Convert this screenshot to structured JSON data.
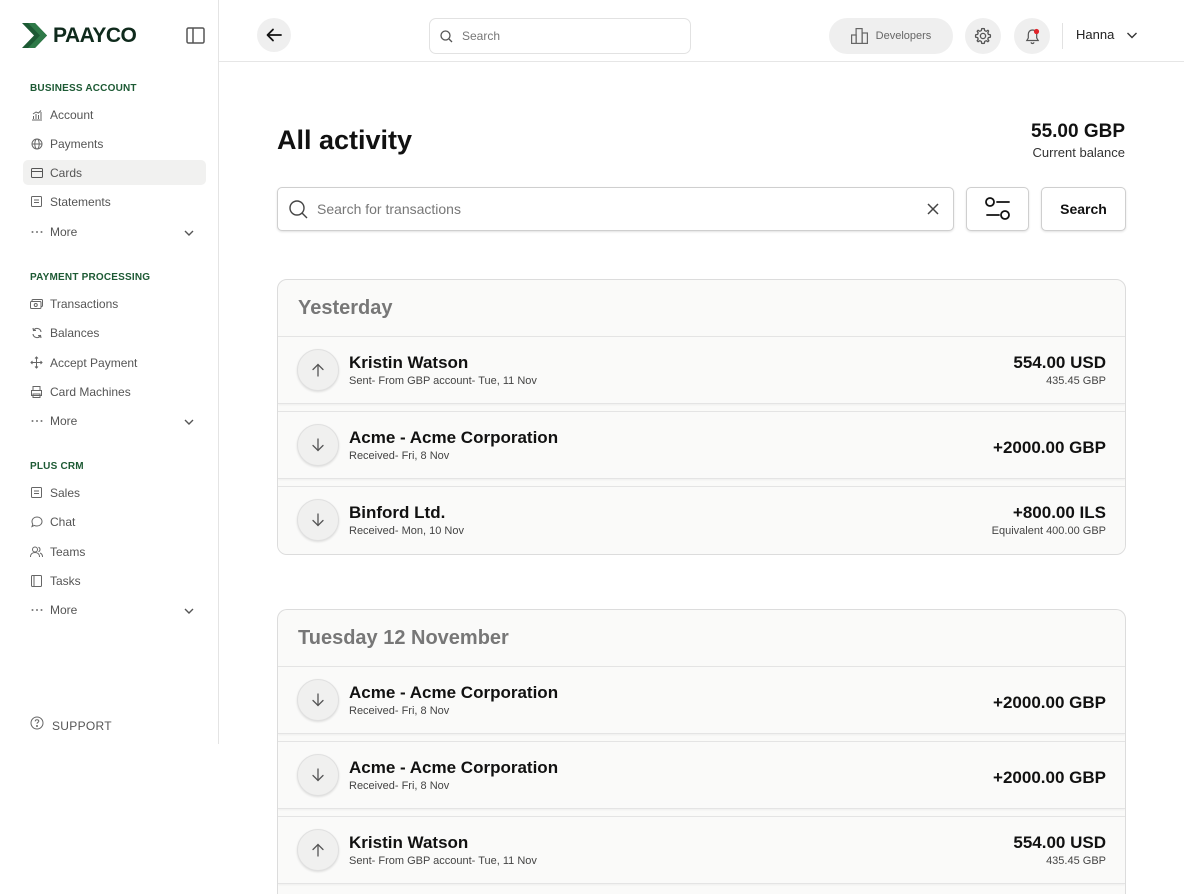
{
  "brand": {
    "name": "PAAYCO",
    "color": "#1d5a34"
  },
  "sidebar": {
    "sections": [
      {
        "title": "BUSINESS ACCOUNT",
        "items": [
          {
            "label": "Account",
            "icon": "chart-icon"
          },
          {
            "label": "Payments",
            "icon": "globe-icon"
          },
          {
            "label": "Cards",
            "icon": "card-icon",
            "active": true
          },
          {
            "label": "Statements",
            "icon": "document-icon"
          },
          {
            "label": "More",
            "icon": "dots-icon"
          }
        ]
      },
      {
        "title": "PAYMENT PROCESSING",
        "items": [
          {
            "label": "Transactions",
            "icon": "cash-icon"
          },
          {
            "label": "Balances",
            "icon": "refresh-icon"
          },
          {
            "label": "Accept Payment",
            "icon": "move-icon"
          },
          {
            "label": "Card Machines",
            "icon": "printer-icon"
          },
          {
            "label": "More",
            "icon": "dots-icon"
          }
        ]
      },
      {
        "title": "PLUS CRM",
        "items": [
          {
            "label": "Sales",
            "icon": "document-icon"
          },
          {
            "label": "Chat",
            "icon": "chat-icon"
          },
          {
            "label": "Teams",
            "icon": "users-icon"
          },
          {
            "label": "Tasks",
            "icon": "book-icon"
          },
          {
            "label": "More",
            "icon": "dots-icon"
          }
        ]
      }
    ],
    "support": "SUPPORT"
  },
  "topbar": {
    "search_placeholder": "Search",
    "developers_label": "Developers",
    "user_name": "Hanna",
    "notification_dot_color": "#e0242a"
  },
  "main": {
    "title": "All activity",
    "balance": {
      "amount": "55.00 GBP",
      "caption": "Current balance"
    },
    "tx_search_placeholder": "Search for transactions",
    "search_button": "Search",
    "groups": [
      {
        "heading": "Yesterday",
        "transactions": [
          {
            "direction": "sent",
            "name": "Kristin Watson",
            "detail": "Sent- From GBP account- Tue, 11 Nov",
            "amount": "554.00 USD",
            "secondary": "435.45 GBP"
          },
          {
            "direction": "received",
            "name": "Acme - Acme Corporation",
            "detail": "Received- Fri, 8 Nov",
            "amount": "+2000.00 GBP",
            "secondary": ""
          },
          {
            "direction": "received",
            "name": "Binford Ltd.",
            "detail": "Received- Mon, 10 Nov",
            "amount": "+800.00 ILS",
            "secondary": "Equivalent 400.00 GBP"
          }
        ]
      },
      {
        "heading": "Tuesday 12 November",
        "transactions": [
          {
            "direction": "received",
            "name": "Acme - Acme Corporation",
            "detail": "Received- Fri, 8 Nov",
            "amount": "+2000.00 GBP",
            "secondary": ""
          },
          {
            "direction": "received",
            "name": "Acme - Acme Corporation",
            "detail": "Received- Fri, 8 Nov",
            "amount": "+2000.00 GBP",
            "secondary": ""
          },
          {
            "direction": "sent",
            "name": "Kristin Watson",
            "detail": "Sent- From GBP account- Tue, 11 Nov",
            "amount": "554.00 USD",
            "secondary": "435.45 GBP"
          }
        ]
      }
    ]
  }
}
